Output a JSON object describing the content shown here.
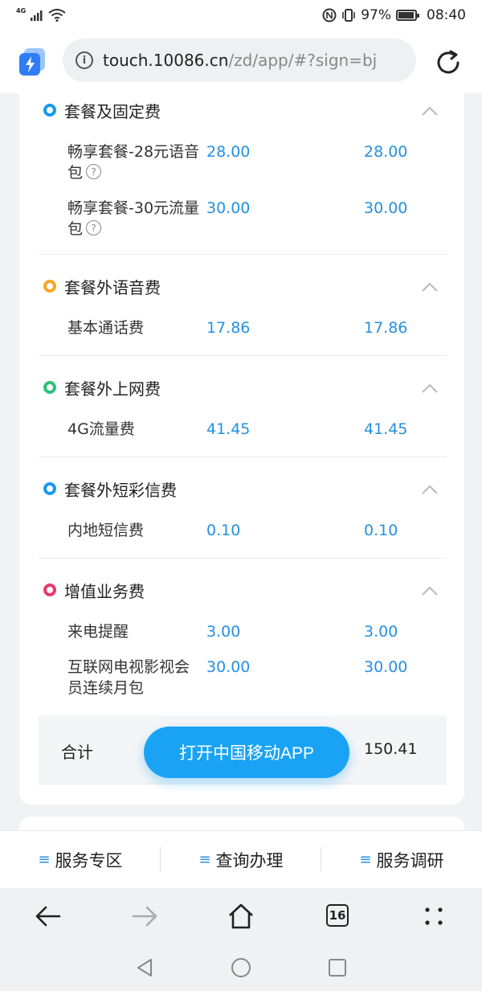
{
  "status_bar": {
    "network": "4G",
    "battery": "97%",
    "time": "08:40"
  },
  "address_bar": {
    "url_host": "touch.10086.cn",
    "url_path": "/zd/app/#?sign=bj"
  },
  "sections": [
    {
      "title": "套餐及固定费",
      "dot_color": "#1a9ae8",
      "rows": [
        {
          "name": "畅享套餐-28元语音包",
          "v1": "28.00",
          "v2": "28.00",
          "help": true
        },
        {
          "name": "畅享套餐-30元流量包",
          "v1": "30.00",
          "v2": "30.00",
          "help": true
        }
      ]
    },
    {
      "title": "套餐外语音费",
      "dot_color": "#f5a623",
      "rows": [
        {
          "name": "基本通话费",
          "v1": "17.86",
          "v2": "17.86"
        }
      ]
    },
    {
      "title": "套餐外上网费",
      "dot_color": "#2ebf7a",
      "rows": [
        {
          "name": "4G流量费",
          "v1": "41.45",
          "v2": "41.45"
        }
      ]
    },
    {
      "title": "套餐外短彩信费",
      "dot_color": "#1a9ae8",
      "rows": [
        {
          "name": "内地短信费",
          "v1": "0.10",
          "v2": "0.10"
        }
      ]
    },
    {
      "title": "增值业务费",
      "dot_color": "#e83a6a",
      "rows": [
        {
          "name": "来电提醒",
          "v1": "3.00",
          "v2": "3.00"
        },
        {
          "name": "互联网电视影视会员连续月包",
          "v1": "30.00",
          "v2": "30.00"
        }
      ]
    }
  ],
  "total": {
    "label": "合计",
    "value": "150.41"
  },
  "open_app_button": "打开中国移动APP",
  "tabs": [
    {
      "label": "服务专区"
    },
    {
      "label": "查询办理"
    },
    {
      "label": "服务调研"
    }
  ],
  "browser_nav": {
    "tab_count": "16"
  },
  "colors": {
    "accent": "#1aa3f5",
    "value_text": "#2590e0"
  }
}
